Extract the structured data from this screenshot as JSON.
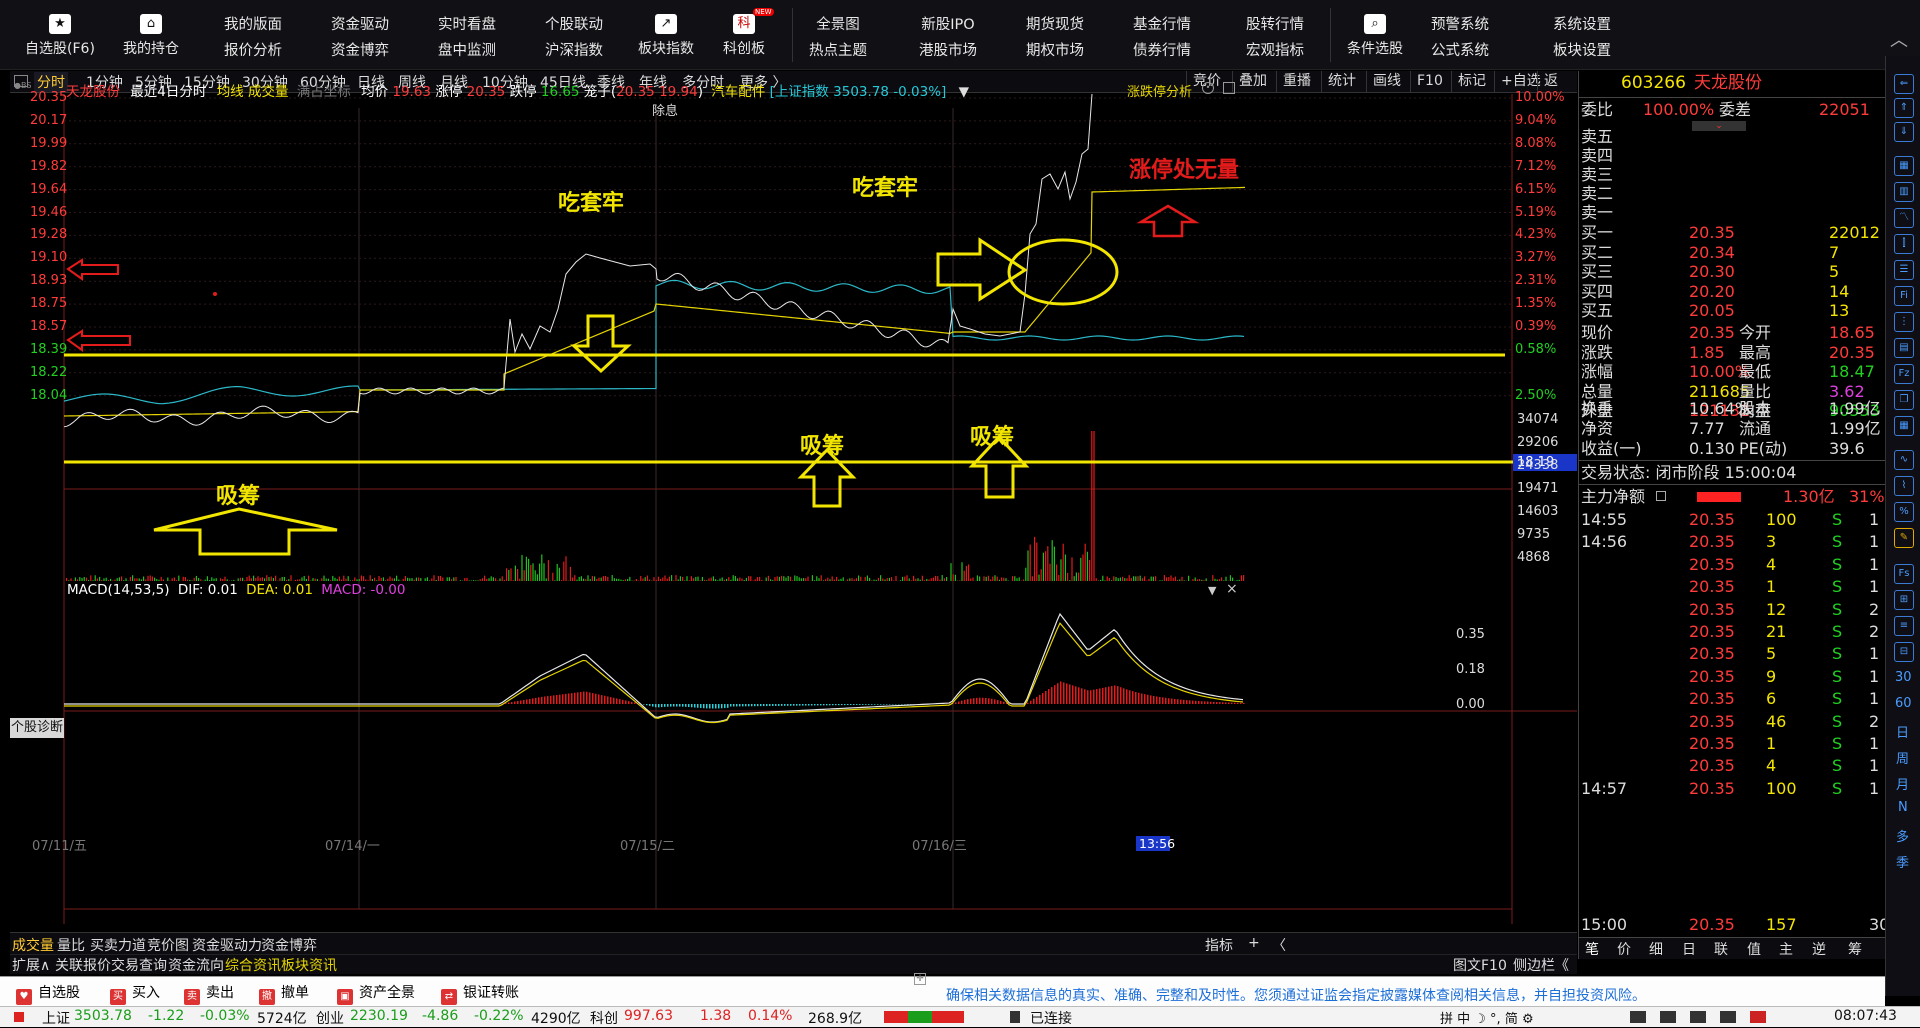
{
  "toolbar": {
    "big": [
      {
        "label": "自选股(F6)",
        "icon": "star-icon"
      },
      {
        "label": "我的持仓",
        "icon": "home-icon"
      }
    ],
    "cols": [
      {
        "top": "我的版面",
        "bottom": "报价分析"
      },
      {
        "top": "资金驱动",
        "bottom": "资金博弈"
      },
      {
        "top": "实时看盘",
        "bottom": "盘中监测"
      },
      {
        "top": "个股联动",
        "bottom": "沪深指数"
      }
    ],
    "big2": [
      {
        "label": "板块指数",
        "icon": "trend-icon"
      },
      {
        "label": "科创板",
        "icon": "kechuang-icon",
        "glyph": "科",
        "badge": "NEW"
      }
    ],
    "cols2": [
      {
        "top": "全景图",
        "bottom": "热点主题"
      },
      {
        "top": "新股IPO",
        "bottom": "港股市场"
      },
      {
        "top": "期货现货",
        "bottom": "期权市场"
      },
      {
        "top": "基金行情",
        "bottom": "债券行情"
      },
      {
        "top": "股转行情",
        "bottom": "宏观指标"
      }
    ],
    "big3": {
      "label": "条件选股",
      "icon": "filter-search-icon"
    },
    "cols3": [
      {
        "top": "预警系统",
        "bottom": "公式系统"
      },
      {
        "top": "系统设置",
        "bottom": "板块设置"
      }
    ]
  },
  "period_tabs": [
    "分时",
    "1分钟",
    "5分钟",
    "15分钟",
    "30分钟",
    "60分钟",
    "日线",
    "周线",
    "月线",
    "10分钟",
    "45日线",
    "季线",
    "年线",
    "多分时",
    "更多 〉"
  ],
  "period_right": [
    "竞价",
    "叠加",
    "重播",
    "统计",
    "画线",
    "F10",
    "标记",
    "+自选",
    "返回"
  ],
  "chart_header": {
    "name": "天龙股份",
    "mode": "最近4日分时",
    "avg_line": "均线",
    "volume": "成交量",
    "full_coord": "满占坐标",
    "avg_price_label": "均价",
    "avg_price": "19.63",
    "limit_up_label": "涨停",
    "limit_up": "20.35",
    "limit_down_label": "跌停",
    "limit_down": "16.65",
    "cage_label": "笼子(",
    "cage_a": "20.35",
    "cage_b": "19.94",
    "cage_close": ")",
    "sector": "汽车配件",
    "index": "[上证指数 3503.78 -0.03%]",
    "ex_div": "除息",
    "limit_analysis": "涨跌停分析"
  },
  "price_axis": [
    "20.35",
    "20.17",
    "19.99",
    "19.82",
    "19.64",
    "19.46",
    "19.28",
    "19.10",
    "18.93",
    "18.75",
    "18.57",
    "18.39",
    "18.22",
    "18.04"
  ],
  "pct_axis": [
    "10.00%",
    "9.04%",
    "8.08%",
    "7.12%",
    "6.15%",
    "5.19%",
    "4.23%",
    "3.27%",
    "2.31%",
    "1.35%",
    "0.39%",
    "0.58%",
    "",
    "2.50%"
  ],
  "current_price_tag": "18.19",
  "volume_axis": [
    "34074",
    "29206",
    "24338",
    "19471",
    "14603",
    "9735",
    "4868"
  ],
  "macd": {
    "label": "MACD(14,53,5)",
    "dif": "DIF: 0.01",
    "dea": "DEA: 0.01",
    "macd": "MACD: -0.00",
    "axis": [
      "0.35",
      "0.18",
      "0.00"
    ]
  },
  "dates": [
    "07/11/五",
    "07/14/一",
    "07/15/二",
    "07/16/三"
  ],
  "cursor_time": "13:56",
  "diag_button": "个股诊断",
  "annotations": {
    "trap1": "吃套牢",
    "trap2": "吃套牢",
    "absorb1": "吸筹",
    "absorb2": "吸筹",
    "absorb3": "吸筹",
    "no_volume": "涨停处无量"
  },
  "quote": {
    "code": "603266",
    "name": "天龙股份",
    "weibi_label": "委比",
    "weibi": "100.00%",
    "weicha_label": "委差",
    "weicha": "22051",
    "asks": [
      {
        "label": "卖五",
        "price": "",
        "vol": ""
      },
      {
        "label": "卖四",
        "price": "",
        "vol": ""
      },
      {
        "label": "卖三",
        "price": "",
        "vol": ""
      },
      {
        "label": "卖二",
        "price": "",
        "vol": ""
      },
      {
        "label": "卖一",
        "price": "",
        "vol": ""
      }
    ],
    "bids": [
      {
        "label": "买一",
        "price": "20.35",
        "vol": "22012"
      },
      {
        "label": "买二",
        "price": "20.34",
        "vol": "7"
      },
      {
        "label": "买三",
        "price": "20.30",
        "vol": "5"
      },
      {
        "label": "买四",
        "price": "20.20",
        "vol": "14"
      },
      {
        "label": "买五",
        "price": "20.05",
        "vol": "13"
      }
    ],
    "stats": [
      {
        "l1": "现价",
        "v1": "20.35",
        "l2": "今开",
        "v2": "18.65",
        "c1": "red",
        "c2": "red"
      },
      {
        "l1": "涨跌",
        "v1": "1.85",
        "l2": "最高",
        "v2": "20.35",
        "c1": "red",
        "c2": "red"
      },
      {
        "l1": "涨幅",
        "v1": "10.00%",
        "l2": "最低",
        "v2": "18.47",
        "c1": "red",
        "c2": "grn"
      },
      {
        "l1": "总量",
        "v1": "211685",
        "l2": "量比",
        "v2": "3.62",
        "c1": "yel",
        "c2": "mag"
      },
      {
        "l1": "外盘",
        "v1": "121132",
        "l2": "内盘",
        "v2": "90553",
        "c1": "red",
        "c2": "grn"
      }
    ],
    "fund": [
      {
        "l1": "换手",
        "v1": "10.64%",
        "l2": "股本",
        "v2": "1.99亿"
      },
      {
        "l1": "净资",
        "v1": "7.77",
        "l2": "流通",
        "v2": "1.99亿"
      },
      {
        "l1": "收益(一)",
        "v1": "0.130",
        "l2": "PE(动)",
        "v2": "39.6"
      }
    ],
    "trade_status": "交易状态: 闭市阶段 15:00:04",
    "main_net_label": "主力净额",
    "main_net": "1.30亿",
    "main_net_pct": "31%",
    "ticks": [
      {
        "time": "14:55",
        "price": "20.35",
        "vol": "100",
        "side": "S",
        "n": "1"
      },
      {
        "time": "14:56",
        "price": "20.35",
        "vol": "3",
        "side": "S",
        "n": "1"
      },
      {
        "time": "",
        "price": "20.35",
        "vol": "4",
        "side": "S",
        "n": "1"
      },
      {
        "time": "",
        "price": "20.35",
        "vol": "1",
        "side": "S",
        "n": "1"
      },
      {
        "time": "",
        "price": "20.35",
        "vol": "12",
        "side": "S",
        "n": "2"
      },
      {
        "time": "",
        "price": "20.35",
        "vol": "21",
        "side": "S",
        "n": "2"
      },
      {
        "time": "",
        "price": "20.35",
        "vol": "5",
        "side": "S",
        "n": "1"
      },
      {
        "time": "",
        "price": "20.35",
        "vol": "9",
        "side": "S",
        "n": "1"
      },
      {
        "time": "",
        "price": "20.35",
        "vol": "6",
        "side": "S",
        "n": "1"
      },
      {
        "time": "",
        "price": "20.35",
        "vol": "46",
        "side": "S",
        "n": "2"
      },
      {
        "time": "",
        "price": "20.35",
        "vol": "1",
        "side": "S",
        "n": "1"
      },
      {
        "time": "",
        "price": "20.35",
        "vol": "4",
        "side": "S",
        "n": "1"
      },
      {
        "time": "14:57",
        "price": "20.35",
        "vol": "100",
        "side": "S",
        "n": "1"
      },
      {
        "time": "15:00",
        "price": "20.35",
        "vol": "157",
        "side": "",
        "n": "30"
      }
    ],
    "bottom_tabs": [
      "笔",
      "价",
      "细",
      "日",
      "联",
      "值",
      "主",
      "逆",
      "筹"
    ]
  },
  "right_strip": [
    "30",
    "60",
    "日",
    "周",
    "月",
    "N",
    "多",
    "季"
  ],
  "bottom_tabs": [
    "成交量",
    "量比",
    "买卖力道",
    "竞价图",
    "资金驱动力",
    "资金博弈"
  ],
  "bottom_right": [
    "指标",
    "+",
    "〈"
  ],
  "expand_bar": [
    "扩展∧",
    "关联报价",
    "交易查询",
    "资金流向",
    "综合资讯",
    "板块资讯"
  ],
  "expand_right": [
    "图文F10",
    "侧边栏《"
  ],
  "actions": [
    {
      "label": "自选股",
      "icon": "heart-icon"
    },
    {
      "label": "买入",
      "icon": "buy-icon",
      "glyph": "买"
    },
    {
      "label": "卖出",
      "icon": "sell-icon",
      "glyph": "卖"
    },
    {
      "label": "撤单",
      "icon": "cancel-order-icon",
      "glyph": "撤"
    },
    {
      "label": "资产全景",
      "icon": "assets-icon"
    },
    {
      "label": "银证转账",
      "icon": "transfer-icon"
    }
  ],
  "disclaimer": "确保相关数据信息的真实、准确、完整和及时性。您须通过证监会指定披露媒体查阅相关信息，并自担投资风险。",
  "status": {
    "sh_label": "上证",
    "sh": "3503.78",
    "sh_chg": "-1.22",
    "sh_pct": "-0.03%",
    "sh_amt": "5724亿",
    "cy_label": "创业",
    "cy": "2230.19",
    "cy_chg": "-4.86",
    "cy_pct": "-0.22%",
    "cy_amt": "4290亿",
    "kc_label": "科创",
    "kc": "997.63",
    "kc_chg": "1.38",
    "kc_pct": "0.14%",
    "kc_amt": "268.9亿",
    "connection": "已连接",
    "time": "08:07:43"
  }
}
